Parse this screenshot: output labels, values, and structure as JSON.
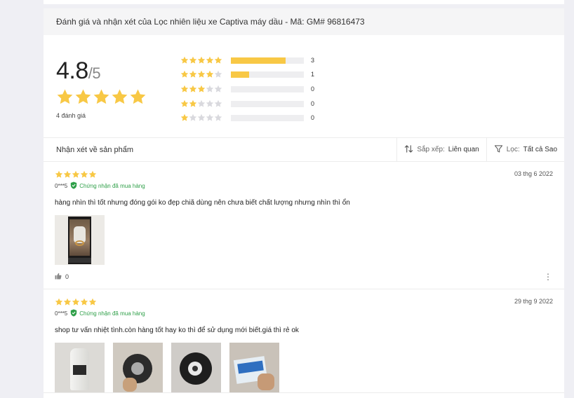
{
  "title": "Đánh giá và nhận xét của Lọc nhiên liệu xe Captiva máy dầu - Mã: GM# 96816473",
  "summary": {
    "score": "4.8",
    "out_of": "/5",
    "rating": 4.8,
    "count_text": "4 đánh giá",
    "star_color": "#f8c845",
    "distribution": [
      {
        "stars": 5,
        "count": "3",
        "fraction": 0.75
      },
      {
        "stars": 4,
        "count": "1",
        "fraction": 0.25
      },
      {
        "stars": 3,
        "count": "0",
        "fraction": 0
      },
      {
        "stars": 2,
        "count": "0",
        "fraction": 0
      },
      {
        "stars": 1,
        "count": "0",
        "fraction": 0
      }
    ]
  },
  "toolbar": {
    "label": "Nhận xét về sản phẩm",
    "sort_prefix": "Sắp xếp:",
    "sort_value": "Liên quan",
    "filter_prefix": "Lọc:",
    "filter_value": "Tất cả Sao"
  },
  "reviews": [
    {
      "stars": 5,
      "user": "0***5",
      "verified": "Chứng nhận đã mua hàng",
      "date": "03 thg 6 2022",
      "text": "hàng nhìn thì tốt nhưng đóng gói ko đẹp chiã dùng nên chưa biết chất lượng nhưng nhìn thì ổn",
      "likes": "0",
      "image_count": 1
    },
    {
      "stars": 5,
      "user": "0***5",
      "verified": "Chứng nhận đã mua hàng",
      "date": "29 thg 9 2022",
      "text": "shop tư vấn nhiệt tình.còn hàng tốt hay ko thì để sử dụng mới biết.giá thì rẻ ok",
      "likes": "",
      "image_count": 4
    }
  ],
  "icons": {
    "star": "star-icon",
    "sort": "sort-icon",
    "filter": "filter-icon",
    "verified": "shield-check-icon",
    "like": "thumbs-up-icon",
    "more": "more-vertical-icon"
  }
}
